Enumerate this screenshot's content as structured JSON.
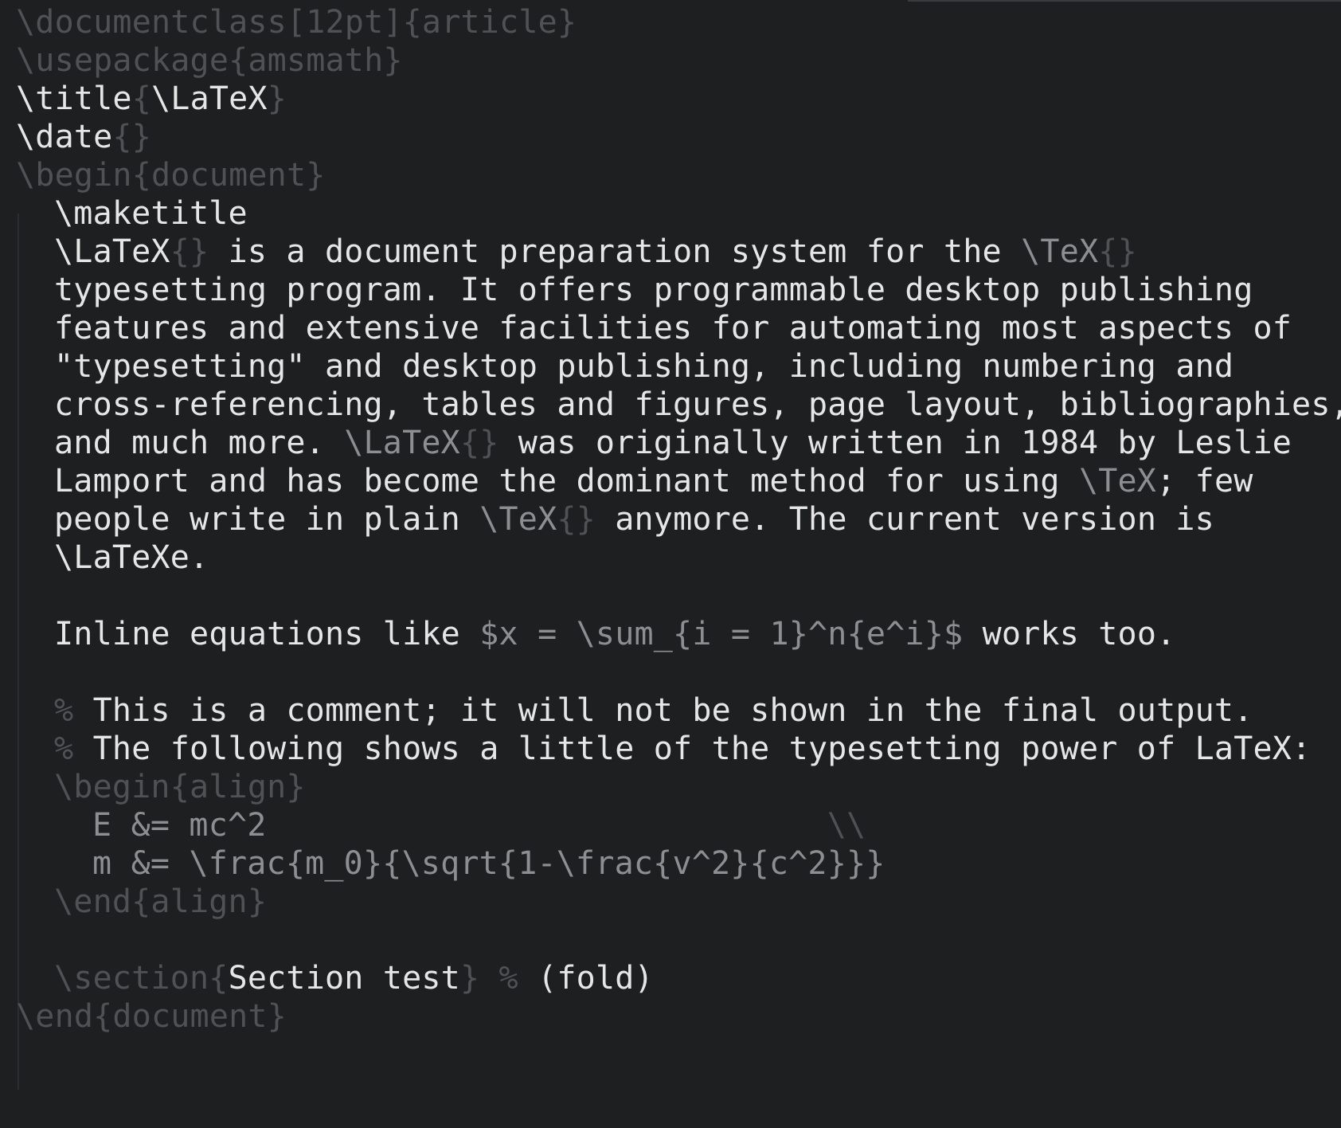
{
  "theme": {
    "background": "#1e1f21",
    "text": "#e6e6e6",
    "dim": "#4f5154",
    "mid": "#8c8e91"
  },
  "lines": {
    "l01": {
      "a": "\\documentclass[12pt]{article}"
    },
    "l02": {
      "a": "\\usepackage{amsmath}"
    },
    "l03": {
      "a": "\\title",
      "b": "{",
      "c": "\\LaTeX",
      "d": "}"
    },
    "l04": {
      "a": "\\date",
      "b": "{}"
    },
    "l05": {
      "a": "\\begin{document}"
    },
    "l06": {
      "a": "\\maketitle"
    },
    "l07": {
      "a": "\\LaTeX",
      "b": "{}",
      "c": " is a document preparation system for the ",
      "d": "\\TeX",
      "e": "{}"
    },
    "l08": {
      "a": "typesetting program. It offers programmable desktop publishing"
    },
    "l09": {
      "a": "features and extensive facilities for automating most aspects of"
    },
    "l10": {
      "a": "\"typesetting\" and desktop publishing, including numbering and"
    },
    "l11": {
      "a": "cross-referencing, tables and figures, page layout, bibliographies,"
    },
    "l12": {
      "a": "and much more. ",
      "b": "\\LaTeX",
      "c": "{}",
      "d": " was originally written in 1984 by Leslie"
    },
    "l13": {
      "a": "Lamport and has become the dominant method for using ",
      "b": "\\TeX",
      "c": "; few"
    },
    "l14": {
      "a": "people write in plain ",
      "b": "\\TeX",
      "c": "{}",
      "d": " anymore. The current version is"
    },
    "l15": {
      "a": "\\LaTeXe."
    },
    "l16": {
      "a": "Inline equations like ",
      "b": "$x = \\sum_{i = 1}^n{e^i}$",
      "c": " works too."
    },
    "l17": {
      "a": "%",
      "b": " This is a comment; it will not be shown in the final output."
    },
    "l18": {
      "a": "%",
      "b": " The following shows a little of the typesetting power of LaTeX:"
    },
    "l19": {
      "a": "\\begin{align}"
    },
    "l20": {
      "a": "E &= mc^2",
      "b": "                             \\\\"
    },
    "l21": {
      "a": "m &= \\frac{m_0}{\\sqrt{1-\\frac{v^2}{c^2}}}"
    },
    "l22": {
      "a": "\\end{align}"
    },
    "l23": {
      "a": "\\section",
      "b": "{",
      "c": "Section test",
      "d": "}",
      "e": " % ",
      "f": "(fold)"
    },
    "l24": {
      "a": "\\end{document}"
    }
  }
}
